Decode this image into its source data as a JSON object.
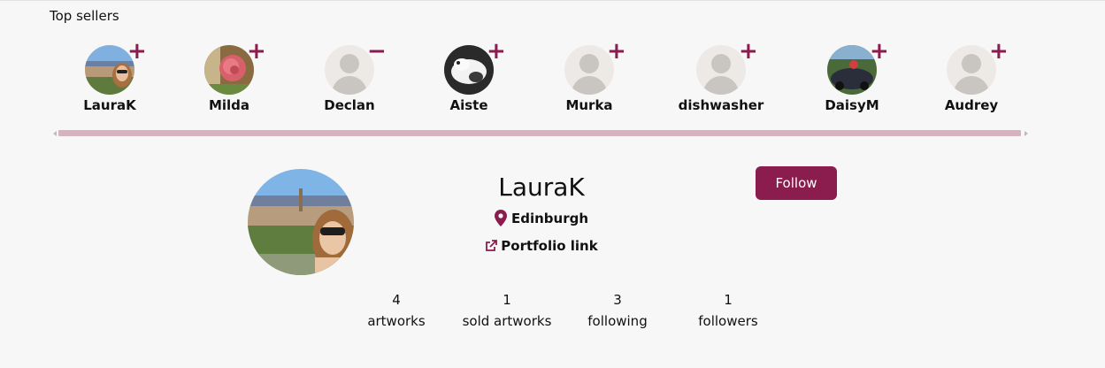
{
  "top_sellers": {
    "title": "Top sellers",
    "sellers": [
      {
        "name": "LauraK",
        "toggle": "+",
        "photo": "landscape-selfie"
      },
      {
        "name": "Milda",
        "toggle": "+",
        "photo": "flower"
      },
      {
        "name": "Declan",
        "toggle": "−",
        "photo": "placeholder"
      },
      {
        "name": "Aiste",
        "toggle": "+",
        "photo": "cat"
      },
      {
        "name": "Murka",
        "toggle": "+",
        "photo": "placeholder"
      },
      {
        "name": "dishwasher",
        "toggle": "+",
        "photo": "placeholder"
      },
      {
        "name": "DaisyM",
        "toggle": "+",
        "photo": "car"
      },
      {
        "name": "Audrey",
        "toggle": "+",
        "photo": "placeholder"
      }
    ]
  },
  "profile": {
    "name": "LauraK",
    "location": "Edinburgh",
    "portfolio_label": "Portfolio link",
    "follow_label": "Follow",
    "stats": [
      {
        "value": "4",
        "label": "artworks"
      },
      {
        "value": "1",
        "label": "sold artworks"
      },
      {
        "value": "3",
        "label": "following"
      },
      {
        "value": "1",
        "label": "followers"
      }
    ]
  },
  "colors": {
    "accent": "#8a1d4e",
    "scrollbar": "#d8b3bf",
    "background": "#f7f7f7"
  },
  "icons": [
    "plus-icon",
    "minus-icon",
    "map-pin-icon",
    "external-link-icon",
    "user-placeholder-icon"
  ]
}
